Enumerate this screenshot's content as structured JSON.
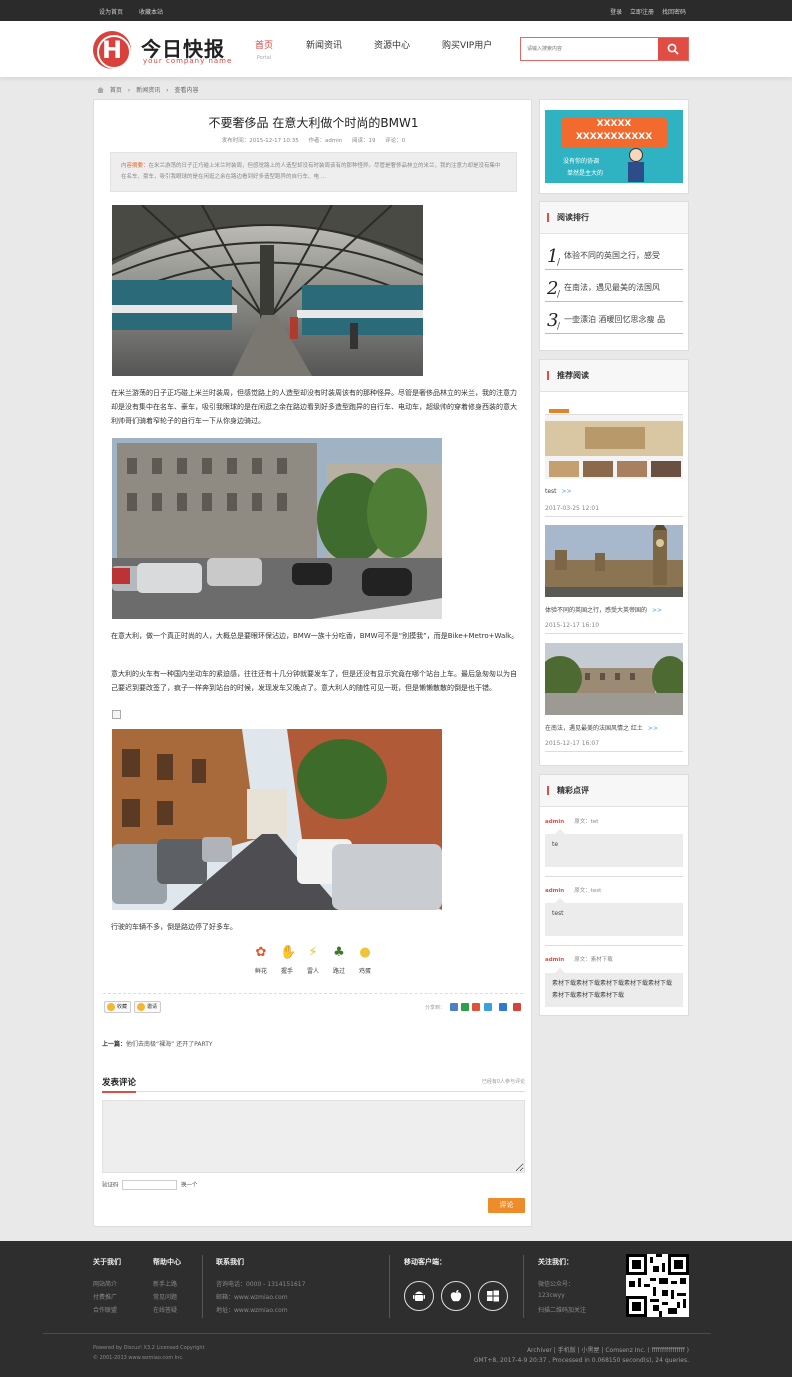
{
  "topbar": {
    "set_home": "设为首页",
    "bookmark": "收藏本站",
    "login": "登录",
    "register": "立即注册",
    "forgot": "找回密码"
  },
  "logo": {
    "letter": "H",
    "title": "今日快报",
    "subtitle": "your company name"
  },
  "nav": [
    {
      "label": "首页",
      "sub": "Portal",
      "active": true
    },
    {
      "label": "新闻资讯"
    },
    {
      "label": "资源中心"
    },
    {
      "label": "购买VIP用户"
    }
  ],
  "search": {
    "placeholder": "请输入搜索内容"
  },
  "breadcrumb": [
    "首页",
    "›",
    "新闻资讯",
    "›",
    "查看内容"
  ],
  "article": {
    "title": "不要奢侈品 在意大利做个时尚的BMW1",
    "meta": {
      "published": "发布时间：2015-12-17 10:35",
      "author": "作者：admin",
      "views": "阅读：19",
      "comments": "评论：0"
    },
    "summary_label": "内容摘要：",
    "summary": "在米兰游荡的日子正巧碰上米兰时装周，但感觉路上的人造型却没有时装周该有的那种怪异。尽管是奢侈品林立的米兰，我的注意力却是没有集中在名车、豪车，吸引我眼球的是在闲逛之余在路边看到好多造型跑异的自行车、电 ...",
    "p1": "在米兰游荡的日子正巧碰上米兰时装周，但感觉路上的人造型却没有时装周该有的那种怪异。尽管是奢侈品林立的米兰，我的注意力却是没有集中在名车、豪车，吸引我眼球的是在闲逛之余在路边看到好多造型跑异的自行车、电动车，超级帅的穿着修身西装的意大利帅哥们骑着窄轮子的自行车一下从你身边骑过。",
    "p2": "在意大利，做一个真正时尚的人，大概总是要眼环保沾边，BMW一族十分吃香，BMW可不是“别摸我”，而是Bike+Metro+Walk。",
    "p3": "意大利的火车有一种国内坐动车的紧迫感，往往还有十几分钟就要发车了，但是还没有显示究竟在哪个站台上车。最后急匆匆以为自己要迟到要改签了，疯子一样奔到站台的时候，发现发车又晚点了。意大利人的随性可见一斑，但是懒懒散散的倒是也干错。",
    "p4": "行驶的车辆不多，倒是路边停了好多车。",
    "reactions": [
      "鲜花",
      "握手",
      "雷人",
      "路过",
      "鸡蛋"
    ],
    "fav": "收藏",
    "invite": "邀请",
    "share_label": "分享到：",
    "prev_label": "上一篇：",
    "prev_title": "他们去南极“裸海” 还开了PARTY"
  },
  "comment_form": {
    "title": "发表评论",
    "count": "已经有0人参与评论",
    "captcha_label": "验证码",
    "refresh": "换一个",
    "submit": "评论"
  },
  "sidebar": {
    "banner": {
      "line1": "XXXXX",
      "line2": "XXXXXXXXXXX",
      "line3": "没有你的协调",
      "line4": "单然是主大的"
    },
    "ranking": {
      "title": "阅读排行",
      "items": [
        {
          "n": "1",
          "title": "体验不同的英国之行，感受"
        },
        {
          "n": "2",
          "title": "在南法，遇见最美的法国风"
        },
        {
          "n": "3",
          "title": "一壶漂泊 酒暖回忆思念瘦 品"
        }
      ]
    },
    "recommend": {
      "title": "推荐阅读",
      "more": ">>",
      "items": [
        {
          "title": "test",
          "date": "2017-03-25 12:01"
        },
        {
          "title": "体验不同的英国之行，感受大英帝国的",
          "date": "2015-12-17 16:10"
        },
        {
          "title": "在南法，遇见最美的法国风情之 红土",
          "date": "2015-12-17 16:07"
        }
      ]
    },
    "comments": {
      "title": "精彩点评",
      "items": [
        {
          "user": "admin",
          "source": "原文：tet",
          "text": "te"
        },
        {
          "user": "admin",
          "source": "原文：test",
          "text": "test"
        },
        {
          "user": "admin",
          "source": "原文：素材下载",
          "text": "素材下载素材下载素材下载素材下载素材下载素材下载素材下载素材下载"
        }
      ]
    }
  },
  "footer": {
    "about": {
      "title": "关于我们",
      "items": [
        "网站简介",
        "付费推广",
        "合作联盟"
      ]
    },
    "help": {
      "title": "帮助中心",
      "items": [
        "新手上路",
        "常见问题",
        "在线答疑"
      ]
    },
    "contact": {
      "title": "联系我们",
      "items": [
        "咨询电话：0000 - 1314151617",
        "邮箱：www.wzmiao.com",
        "地址：www.wzmiao.com"
      ]
    },
    "mobile": {
      "title": "移动客户端："
    },
    "follow": {
      "title": "关注我们：",
      "items": [
        "微信公众号：",
        "123cwyy",
        "扫描二维码加关注"
      ]
    },
    "powered": "Powered by Discuz! X3.2 Licensed Copyright",
    "copyright": "© 2001-2013 www.wzmiao.com Inc.",
    "links": "Archiver | 手机版 | 小黑屋 | Comsenz Inc. ( ffffffffffffffff )",
    "stats": "GMT+8, 2017-4-9 20:37 , Processed in 0.068150 second(s), 24 queries."
  }
}
